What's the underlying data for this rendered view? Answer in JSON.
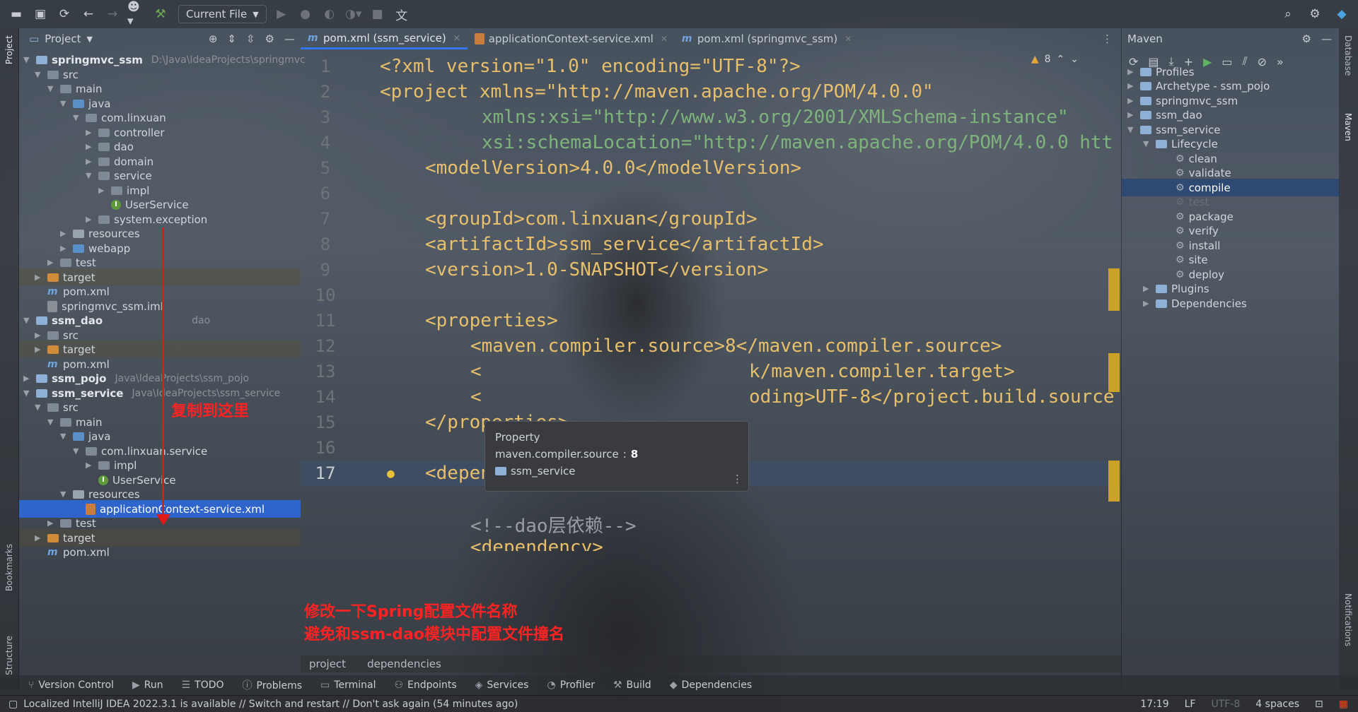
{
  "toolbar": {
    "run_config": "Current File"
  },
  "left_stripe": {
    "project": "Project",
    "bookmarks": "Bookmarks",
    "structure": "Structure"
  },
  "project_panel": {
    "title": "Project",
    "tree": [
      {
        "label": "springmvc_ssm",
        "hint": "D:\\Java\\IdeaProjects\\springmvc",
        "bold": true
      },
      {
        "label": "src"
      },
      {
        "label": "main"
      },
      {
        "label": "java"
      },
      {
        "label": "com.linxuan"
      },
      {
        "label": "controller"
      },
      {
        "label": "dao"
      },
      {
        "label": "domain"
      },
      {
        "label": "service"
      },
      {
        "label": "impl"
      },
      {
        "label": "UserService"
      },
      {
        "label": "system.exception"
      },
      {
        "label": "resources"
      },
      {
        "label": "webapp"
      },
      {
        "label": "test"
      },
      {
        "label": "target"
      },
      {
        "label": "pom.xml"
      },
      {
        "label": "springmvc_ssm.iml"
      },
      {
        "label": "ssm_dao",
        "hint": "dao",
        "bold": true
      },
      {
        "label": "src"
      },
      {
        "label": "target"
      },
      {
        "label": "pom.xml"
      },
      {
        "label": "ssm_pojo",
        "hint": "Java\\IdeaProjects\\ssm_pojo",
        "bold": true
      },
      {
        "label": "ssm_service",
        "hint": "Java\\IdeaProjects\\ssm_service",
        "bold": true
      },
      {
        "label": "src"
      },
      {
        "label": "main"
      },
      {
        "label": "java"
      },
      {
        "label": "com.linxuan.service"
      },
      {
        "label": "impl"
      },
      {
        "label": "UserService"
      },
      {
        "label": "resources"
      },
      {
        "label": "applicationContext-service.xml"
      },
      {
        "label": "test"
      },
      {
        "label": "target"
      },
      {
        "label": "pom.xml"
      }
    ]
  },
  "editor": {
    "tabs": [
      {
        "label": "pom.xml (ssm_service)"
      },
      {
        "label": "applicationContext-service.xml"
      },
      {
        "label": "pom.xml (springmvc_ssm)"
      }
    ],
    "warnings": "8",
    "lines": [
      "1",
      "2",
      "3",
      "4",
      "5",
      "6",
      "7",
      "8",
      "9",
      "10",
      "11",
      "12",
      "13",
      "14",
      "15",
      "16",
      "17"
    ],
    "code": {
      "l1": "<?xml version=\"1.0\" encoding=\"UTF-8\"?>",
      "l2": "<project xmlns=\"http://maven.apache.org/POM/4.0.0\"",
      "l3": "xmlns:xsi=\"http://www.w3.org/2001/XMLSchema-instance\"",
      "l4": "xsi:schemaLocation=\"http://maven.apache.org/POM/4.0.0 htt",
      "l5": "<modelVersion>4.0.0</modelVersion>",
      "l7": "<groupId>com.linxuan</groupId>",
      "l8": "<artifactId>ssm_service</artifactId>",
      "l9": "<version>1.0-SNAPSHOT</version>",
      "l11": "<properties>",
      "l12": "<maven.compiler.source>8</maven.compiler.source>",
      "l13a": "<",
      "l13b": "k/maven.compiler.target>",
      "l14a": "<",
      "l14b": "oding>UTF-8</project.build.source",
      "l15": "</properties>",
      "l17": "<dependencies>",
      "l19": "<!--dao层依赖-->",
      "l20": "<dependency>"
    },
    "tooltip": {
      "title": "Property",
      "name": "maven.compiler.source",
      "value": "8",
      "module": "ssm_service"
    },
    "breadcrumb": [
      "project",
      "dependencies"
    ]
  },
  "maven": {
    "title": "Maven",
    "items": [
      {
        "label": "Profiles"
      },
      {
        "label": "Archetype - ssm_pojo"
      },
      {
        "label": "springmvc_ssm"
      },
      {
        "label": "ssm_dao"
      },
      {
        "label": "ssm_service"
      },
      {
        "label": "Lifecycle"
      },
      {
        "label": "clean"
      },
      {
        "label": "validate"
      },
      {
        "label": "compile"
      },
      {
        "label": "test"
      },
      {
        "label": "package"
      },
      {
        "label": "verify"
      },
      {
        "label": "install"
      },
      {
        "label": "site"
      },
      {
        "label": "deploy"
      },
      {
        "label": "Plugins"
      },
      {
        "label": "Dependencies"
      }
    ]
  },
  "right_stripe": {
    "database": "Database",
    "maven": "Maven",
    "notifications": "Notifications"
  },
  "tool_tabs": [
    "Version Control",
    "Run",
    "TODO",
    "Problems",
    "Terminal",
    "Endpoints",
    "Services",
    "Profiler",
    "Build",
    "Dependencies"
  ],
  "status": {
    "message": "Localized IntelliJ IDEA 2022.3.1 is available // Switch and restart // Don't ask again (54 minutes ago)",
    "position": "17:19",
    "line_sep": "LF",
    "encoding": "UTF-8",
    "indent": "4 spaces"
  },
  "annotations": {
    "copy_here": "复制到这里",
    "rename_line1": "修改一下Spring配置文件名称",
    "rename_line2": "避免和ssm-dao模块中配置文件撞名"
  }
}
